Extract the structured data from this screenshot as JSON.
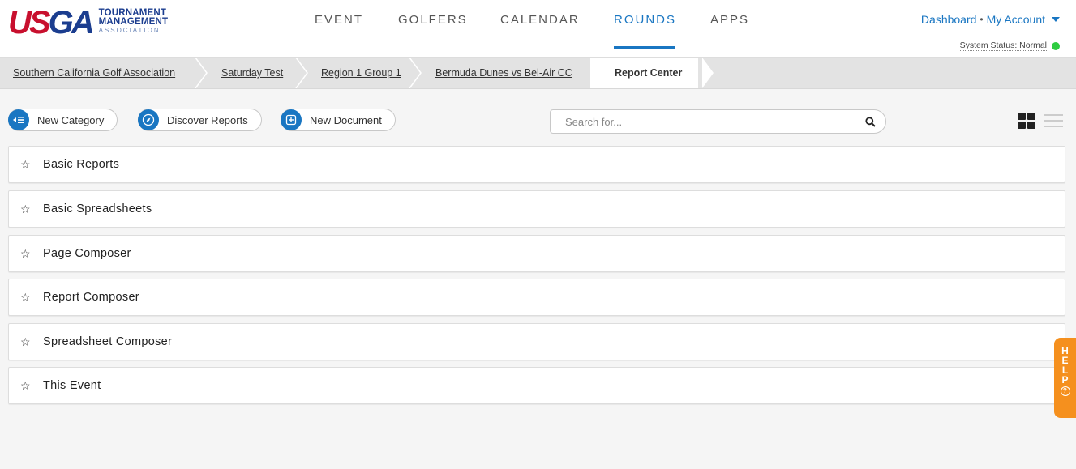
{
  "logo": {
    "mark_u": "US",
    "mark_rest": "GA",
    "line1": "TOURNAMENT",
    "line2": "MANAGEMENT",
    "line3": "ASSOCIATION"
  },
  "nav": {
    "items": [
      {
        "label": "EVENT"
      },
      {
        "label": "GOLFERS"
      },
      {
        "label": "CALENDAR"
      },
      {
        "label": "ROUNDS"
      },
      {
        "label": "APPS"
      }
    ],
    "active": "ROUNDS"
  },
  "account": {
    "dashboard": "Dashboard",
    "separator": "•",
    "my_account": "My Account",
    "status_label": "System Status: Normal",
    "status_color": "#2ecc40"
  },
  "breadcrumb": [
    {
      "label": "Southern California Golf Association"
    },
    {
      "label": "Saturday Test"
    },
    {
      "label": "Region 1 Group 1"
    },
    {
      "label": "Bermuda Dunes vs Bel-Air CC"
    },
    {
      "label": "Report Center"
    }
  ],
  "toolbar": {
    "new_category": "New Category",
    "discover_reports": "Discover Reports",
    "new_document": "New Document",
    "search_placeholder": "Search for..."
  },
  "categories": [
    {
      "name": "Basic Reports"
    },
    {
      "name": "Basic Spreadsheets"
    },
    {
      "name": "Page Composer"
    },
    {
      "name": "Report Composer"
    },
    {
      "name": "Spreadsheet Composer"
    },
    {
      "name": "This Event"
    }
  ],
  "help": {
    "letters": [
      "H",
      "E",
      "L",
      "P"
    ],
    "icon": "?"
  },
  "colors": {
    "accent": "#1976c2",
    "help": "#f5901e",
    "brand_red": "#c8102e",
    "brand_blue": "#1b3d8f"
  }
}
